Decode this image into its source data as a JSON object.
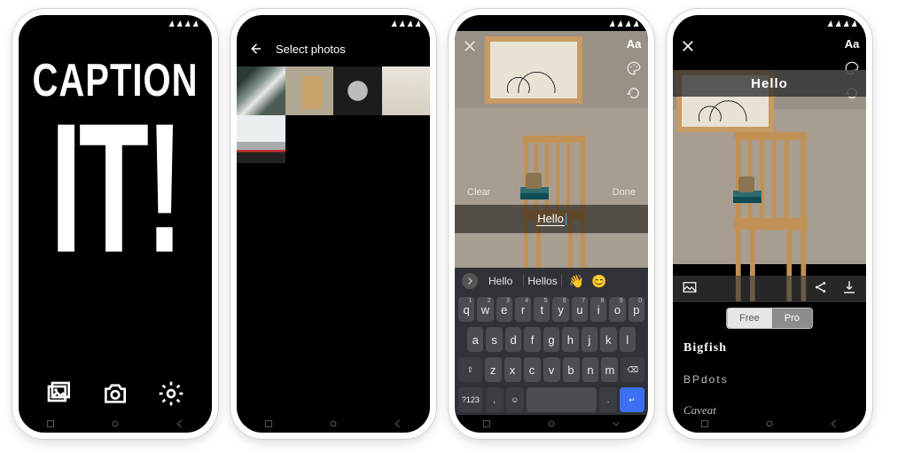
{
  "statusbar": {
    "time": ""
  },
  "splash": {
    "word1": "CAPTION",
    "word2": "IT!",
    "actions": {
      "gallery": "gallery",
      "camera": "camera",
      "settings": "settings"
    }
  },
  "picker": {
    "title": "Select photos",
    "thumbs": [
      "waterfall",
      "chair-room",
      "car-front",
      "roots",
      "red-classic-car"
    ]
  },
  "editor": {
    "clear": "Clear",
    "done": "Done",
    "text_value": "Hello",
    "tools": {
      "font": "Aa",
      "palette": "palette",
      "rotate": "rotate"
    }
  },
  "keyboard": {
    "suggestions": [
      "Hello",
      "Hellos",
      "👋",
      "😊"
    ],
    "rows": {
      "r1": [
        [
          "q",
          "1"
        ],
        [
          "w",
          "2"
        ],
        [
          "e",
          "3"
        ],
        [
          "r",
          "4"
        ],
        [
          "t",
          "5"
        ],
        [
          "y",
          "6"
        ],
        [
          "u",
          "7"
        ],
        [
          "i",
          "8"
        ],
        [
          "o",
          "9"
        ],
        [
          "p",
          "0"
        ]
      ],
      "r2": [
        "a",
        "s",
        "d",
        "f",
        "g",
        "h",
        "j",
        "k",
        "l"
      ],
      "r3": [
        "z",
        "x",
        "c",
        "v",
        "b",
        "n",
        "m"
      ],
      "shift": "⇧",
      "bksp": "⌫",
      "sym": "?123",
      "comma": ",",
      "emoji": "☺",
      "space": " ",
      "dot": ".",
      "enter": "↵"
    }
  },
  "fonts": {
    "caption_text": "Hello",
    "segmented": {
      "free": "Free",
      "pro": "Pro",
      "active": "pro"
    },
    "list": [
      "Bigfish",
      "BPdots",
      "Caveat"
    ]
  }
}
